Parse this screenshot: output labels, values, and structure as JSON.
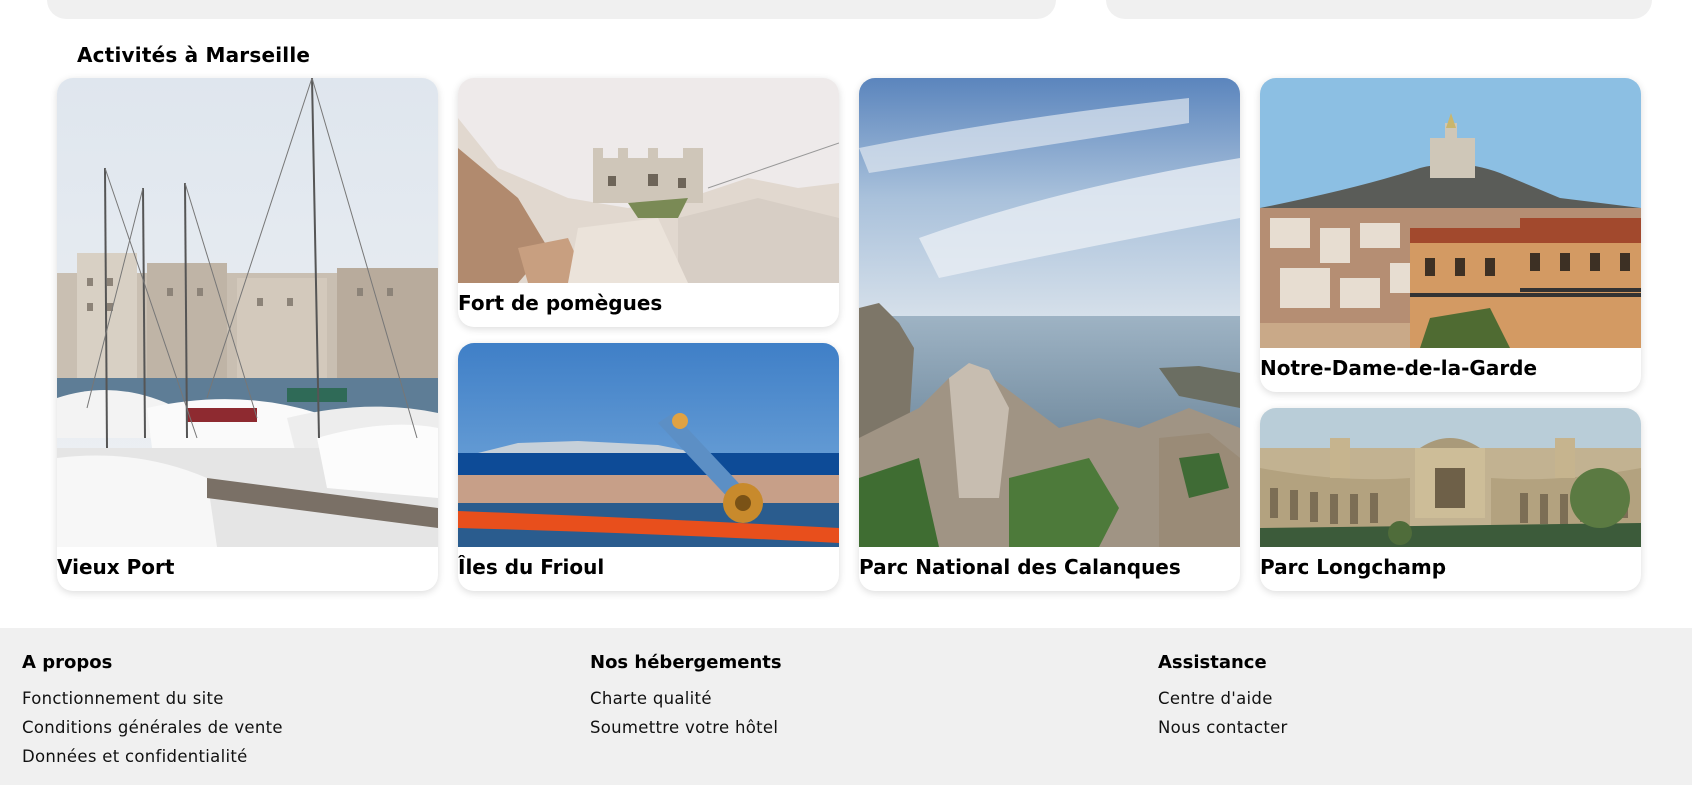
{
  "section": {
    "title": "Activités à Marseille"
  },
  "activities": [
    {
      "label": "Vieux Port"
    },
    {
      "label": "Fort de pomègues"
    },
    {
      "label": "Îles du Frioul"
    },
    {
      "label": "Parc National des Calanques"
    },
    {
      "label": "Notre-Dame-de-la-Garde"
    },
    {
      "label": "Parc Longchamp"
    }
  ],
  "footer": {
    "columns": [
      {
        "heading": "A propos",
        "links": [
          "Fonctionnement du site",
          "Conditions générales de vente",
          "Données et confidentialité"
        ]
      },
      {
        "heading": "Nos hébergements",
        "links": [
          "Charte qualité",
          "Soumettre votre hôtel"
        ]
      },
      {
        "heading": "Assistance",
        "links": [
          "Centre d'aide",
          "Nous contacter"
        ]
      }
    ]
  }
}
